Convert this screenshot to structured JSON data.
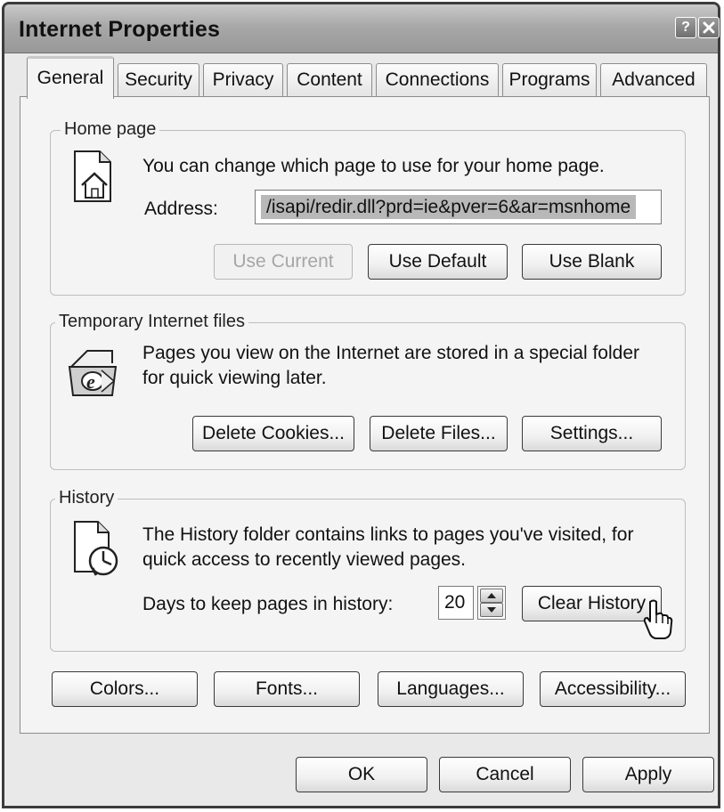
{
  "window": {
    "title": "Internet Properties",
    "help_glyph": "?",
    "close_icon": "close-icon"
  },
  "tabs": [
    {
      "label": "General",
      "active": true
    },
    {
      "label": "Security",
      "active": false
    },
    {
      "label": "Privacy",
      "active": false
    },
    {
      "label": "Content",
      "active": false
    },
    {
      "label": "Connections",
      "active": false
    },
    {
      "label": "Programs",
      "active": false
    },
    {
      "label": "Advanced",
      "active": false
    }
  ],
  "home_page": {
    "legend": "Home page",
    "description": "You can change which page to use for your home page.",
    "address_label": "Address:",
    "address_value": "/isapi/redir.dll?prd=ie&pver=6&ar=msnhome",
    "use_current": "Use Current",
    "use_default": "Use Default",
    "use_blank": "Use Blank",
    "icon": "home-page-icon"
  },
  "temp_files": {
    "legend": "Temporary Internet files",
    "description_line1": "Pages you view on the Internet are stored in a special folder",
    "description_line2": "for quick viewing later.",
    "delete_cookies": "Delete Cookies...",
    "delete_files": "Delete Files...",
    "settings": "Settings...",
    "icon": "ie-folder-icon"
  },
  "history": {
    "legend": "History",
    "description_line1": "The History folder contains links to pages you've visited, for",
    "description_line2": "quick access to recently viewed pages.",
    "days_label": "Days to keep pages in history:",
    "days_value": "20",
    "clear_history": "Clear History",
    "icon": "history-icon"
  },
  "bottom_buttons": {
    "colors": "Colors...",
    "fonts": "Fonts...",
    "languages": "Languages...",
    "accessibility": "Accessibility..."
  },
  "dialog_buttons": {
    "ok": "OK",
    "cancel": "Cancel",
    "apply": "Apply"
  }
}
